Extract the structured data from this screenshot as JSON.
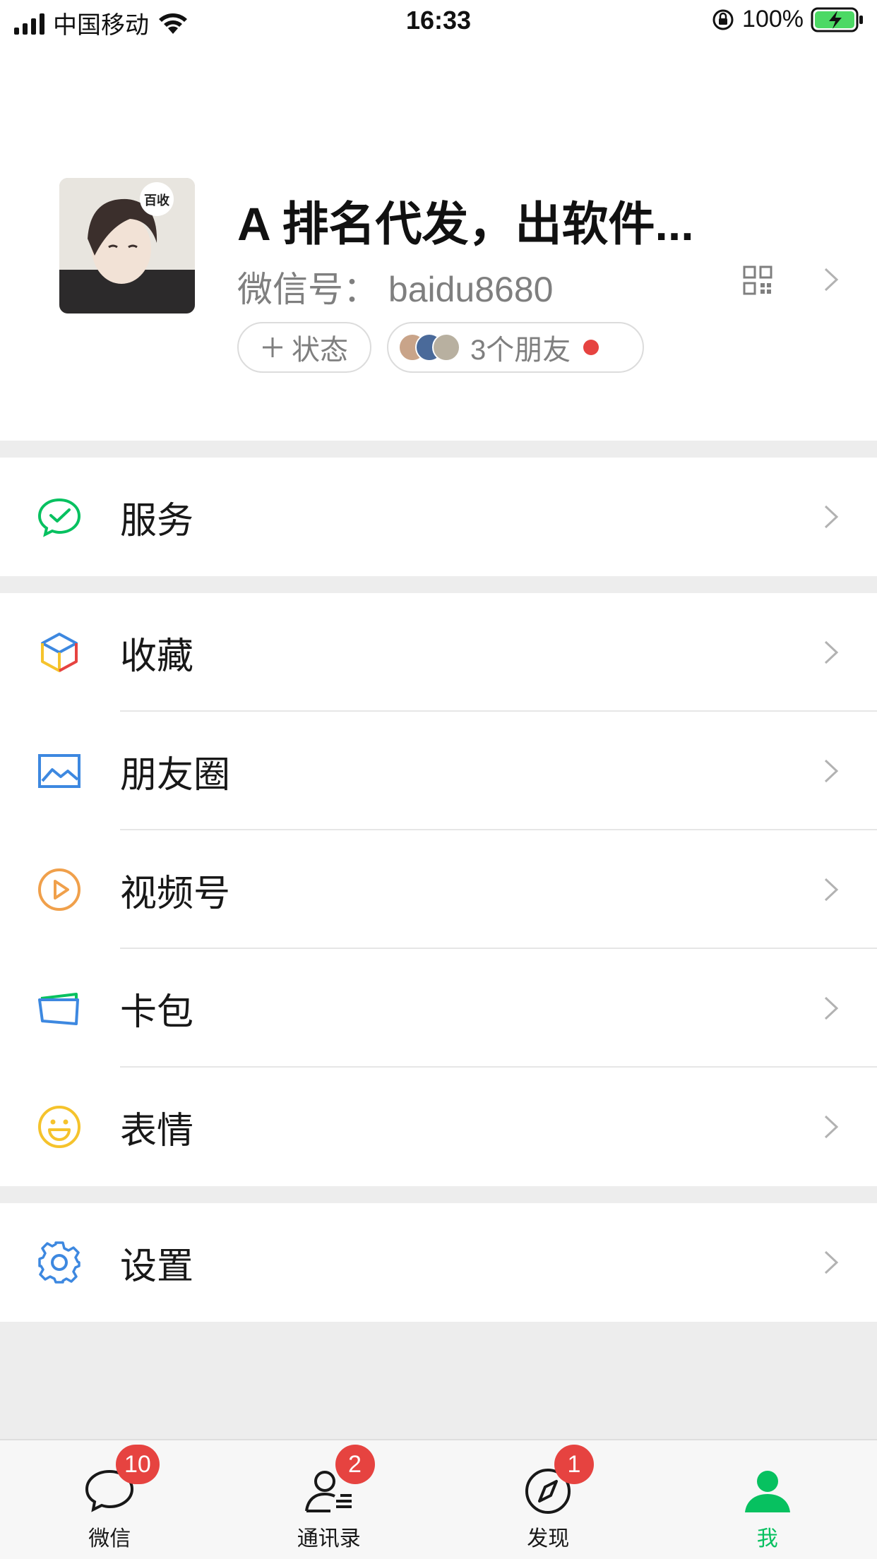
{
  "status_bar": {
    "carrier": "中国移动",
    "time": "16:33",
    "battery": "100%"
  },
  "profile": {
    "nickname": "A 排名代发，出软件...",
    "wechat_id": "微信号：  baidu8680",
    "avatar_badge": "百收",
    "status_chip": "状态",
    "friends_chip": "3个朋友"
  },
  "menu": {
    "services": "服务",
    "favorites": "收藏",
    "moments": "朋友圈",
    "channels": "视频号",
    "cards": "卡包",
    "stickers": "表情",
    "settings": "设置"
  },
  "tabbar": {
    "tabs": [
      {
        "label": "微信",
        "badge": "10",
        "icon": "chat-icon"
      },
      {
        "label": "通讯录",
        "badge": "2",
        "icon": "contacts-icon"
      },
      {
        "label": "发现",
        "badge": "1",
        "icon": "compass-icon"
      },
      {
        "label": "我",
        "badge": "",
        "icon": "person-icon"
      }
    ]
  },
  "colors": {
    "accent_green": "#07c160",
    "badge_red": "#e64340",
    "background": "#ededed"
  }
}
